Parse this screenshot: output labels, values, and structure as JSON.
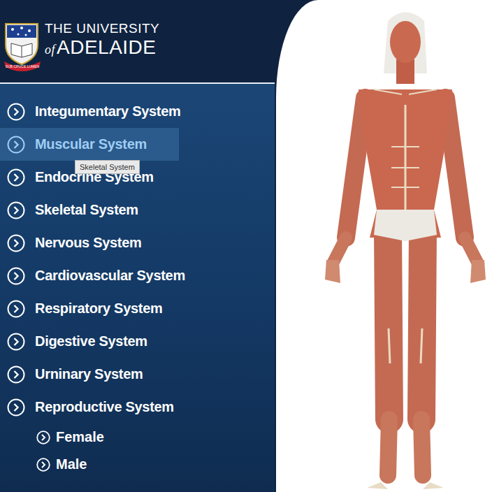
{
  "header": {
    "logo": {
      "line1": "THE UNIVERSITY",
      "line2_prefix": "of",
      "line2": "ADELAIDE",
      "motto": "SUB CRUCE LUMEN"
    }
  },
  "menu": {
    "items": [
      {
        "label": "Integumentary System",
        "selected": false
      },
      {
        "label": "Muscular System",
        "selected": true
      },
      {
        "label": "Endocrine System",
        "selected": false
      },
      {
        "label": "Skeletal System",
        "selected": false
      },
      {
        "label": "Nervous System",
        "selected": false
      },
      {
        "label": "Cardiovascular System",
        "selected": false
      },
      {
        "label": "Respiratory System",
        "selected": false
      },
      {
        "label": "Digestive System",
        "selected": false
      },
      {
        "label": "Urninary System",
        "selected": false
      },
      {
        "label": "Reproductive System",
        "selected": false
      }
    ],
    "sub_items": [
      {
        "label": "Female",
        "selected": false
      },
      {
        "label": "Male",
        "selected": false
      }
    ]
  },
  "tooltip": {
    "text": "Skeletal System"
  }
}
